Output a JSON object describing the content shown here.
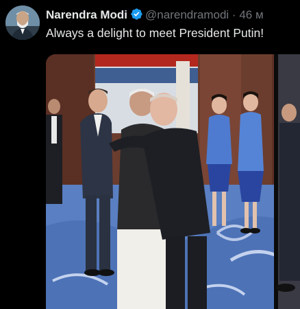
{
  "tweet": {
    "author_name": "Narendra Modi",
    "handle": "@narendramodi",
    "separator": "·",
    "time": "46 м",
    "text": "Always a delight to meet President Putin!"
  },
  "icons": {
    "verified": "verified-badge-icon",
    "avatar": "profile-avatar"
  },
  "colors": {
    "background": "#000000",
    "verified_blue": "#1d9bf0",
    "handle_grey": "#71767b"
  }
}
